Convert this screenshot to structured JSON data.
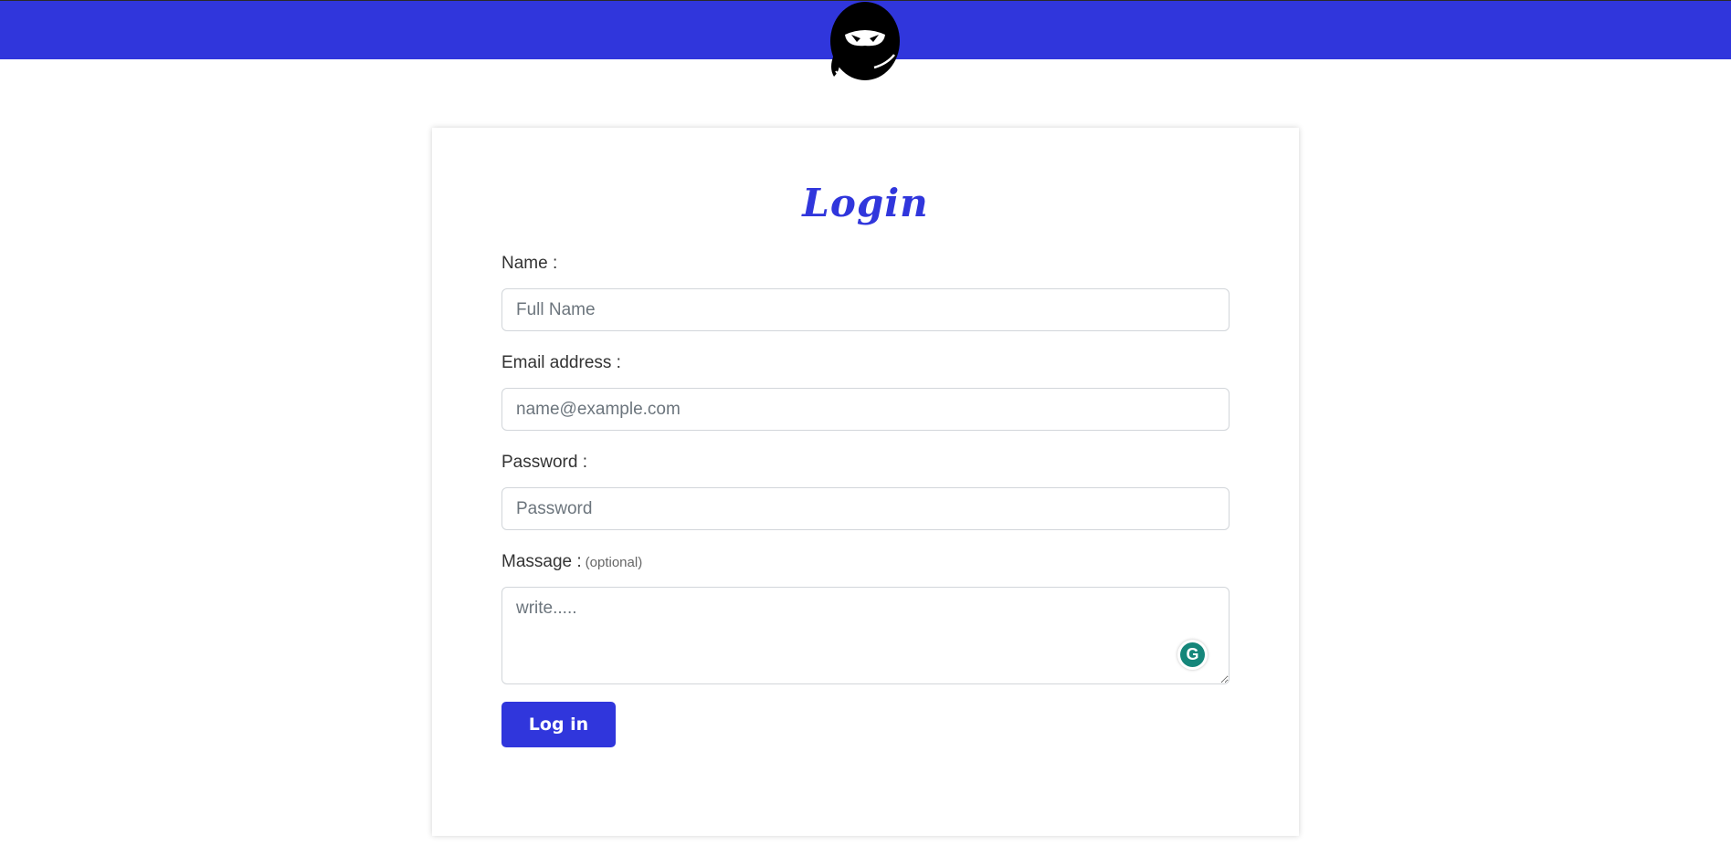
{
  "header": {
    "logo_icon": "ninja-head-icon",
    "background_color": "#3036dc"
  },
  "form": {
    "title": "Login",
    "name_label": "Name :",
    "name_placeholder": "Full Name",
    "email_label": "Email address :",
    "email_placeholder": "name@example.com",
    "password_label": "Password :",
    "password_placeholder": "Password",
    "message_label": "Massage :",
    "message_optional": "(optional)",
    "message_placeholder": "write.....",
    "submit_label": "Log in",
    "accent_color": "#3036dc"
  },
  "grammarly": {
    "icon": "grammarly-icon",
    "glyph": "G"
  }
}
